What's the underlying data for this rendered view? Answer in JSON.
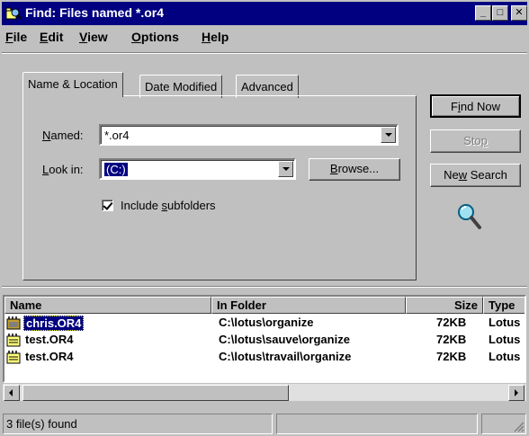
{
  "window": {
    "title": "Find: Files named *.or4"
  },
  "title_buttons": {
    "minimize": "_",
    "maximize": "□",
    "close": "✕"
  },
  "menu": [
    {
      "label": "File",
      "key": "F",
      "rest": "ile"
    },
    {
      "label": "Edit",
      "key": "E",
      "rest": "dit"
    },
    {
      "label": "View",
      "key": "V",
      "rest": "iew"
    },
    {
      "label": "Options",
      "key": "O",
      "rest": "ptions"
    },
    {
      "label": "Help",
      "key": "H",
      "rest": "elp"
    }
  ],
  "tabs": [
    {
      "label": "Name & Location",
      "active": true
    },
    {
      "label": "Date Modified",
      "active": false
    },
    {
      "label": "Advanced",
      "active": false
    }
  ],
  "form": {
    "named_label_key": "N",
    "named_label_rest": "amed:",
    "named_value": "*.or4",
    "lookin_label_key": "L",
    "lookin_label_rest": "ook in:",
    "lookin_value": "(C:)",
    "browse_key": "B",
    "browse_rest": "rowse...",
    "include_pre": "Include ",
    "include_key": "s",
    "include_rest": "ubfolders",
    "include_checked": true
  },
  "buttons": {
    "find_pre": "F",
    "find_key": "i",
    "find_rest": "nd Now",
    "stop_pre": "Sto",
    "stop_key": "p",
    "newsearch_pre": "Ne",
    "newsearch_key": "w",
    "newsearch_rest": " Search"
  },
  "results": {
    "columns": [
      "Name",
      "In Folder",
      "Size",
      "Type"
    ],
    "rows": [
      {
        "name": "chris.OR4",
        "folder": "C:\\lotus\\organize",
        "size": "72KB",
        "type": "Lotus",
        "selected": true
      },
      {
        "name": "test.OR4",
        "folder": "C:\\lotus\\sauve\\organize",
        "size": "72KB",
        "type": "Lotus",
        "selected": false
      },
      {
        "name": "test.OR4",
        "folder": "C:\\lotus\\travail\\organize",
        "size": "72KB",
        "type": "Lotus",
        "selected": false
      }
    ]
  },
  "status": {
    "text": "3 file(s) found"
  },
  "colors": {
    "titlebar": "#000080",
    "face": "#c0c0c0",
    "selection": "#000080"
  },
  "icons": {
    "app": "find-search-icon",
    "magnifier": "magnifier-icon",
    "file": "organizer-file-icon"
  }
}
